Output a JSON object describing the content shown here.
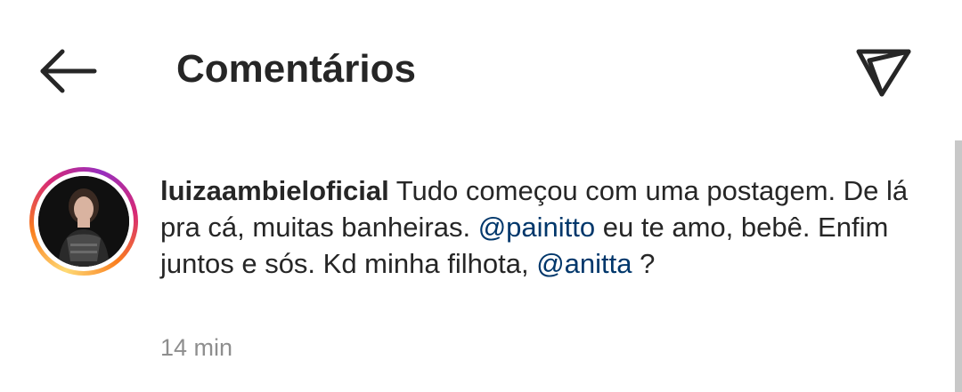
{
  "header": {
    "title": "Comentários",
    "back_icon": "arrow-left-icon",
    "share_icon": "paper-plane-icon"
  },
  "comment": {
    "username": "luizaambieloficial",
    "text_part1": "Tudo começou com uma postagem. De lá pra cá, muitas banheiras.",
    "mention1": "@painitto",
    "text_part2": "eu te amo, bebê. Enfim juntos e sós. Kd minha filhota,",
    "mention2": "@anitta",
    "text_part3": "?",
    "time": "14 min"
  },
  "colors": {
    "text": "#262626",
    "mention": "#00376b",
    "muted": "#8e8e8e",
    "story_ring": [
      "#feda75",
      "#fa7e1e",
      "#d62976",
      "#962fbf"
    ]
  }
}
